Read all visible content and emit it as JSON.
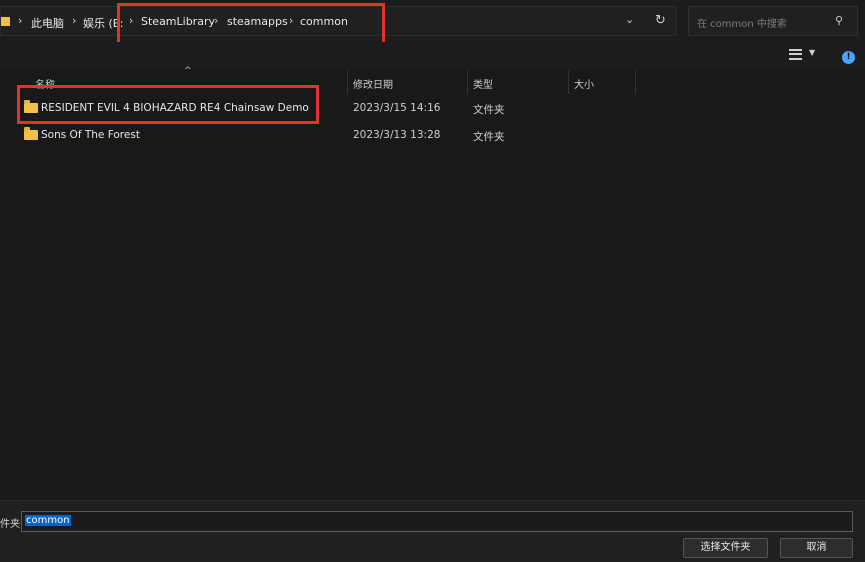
{
  "breadcrumb": {
    "items": [
      "此电脑",
      "娱乐 (E:",
      "SteamLibrary",
      "steamapps",
      "common"
    ]
  },
  "search": {
    "placeholder": "在 common 中搜索"
  },
  "columns": {
    "name": "名称",
    "date": "修改日期",
    "type": "类型",
    "size": "大小"
  },
  "files": [
    {
      "name": "RESIDENT EVIL 4  BIOHAZARD RE4 Chainsaw Demo",
      "date": "2023/3/15 14:16",
      "type": "文件夹"
    },
    {
      "name": "Sons Of The Forest",
      "date": "2023/3/13 13:28",
      "type": "文件夹"
    }
  ],
  "footer": {
    "folder_label": "件夹:",
    "folder_value": "common",
    "select_label": "选择文件夹",
    "cancel_label": "取消"
  },
  "colors": {
    "highlight": "#e0332f",
    "selection": "#0a64c8",
    "folder": "#f0c14b"
  }
}
